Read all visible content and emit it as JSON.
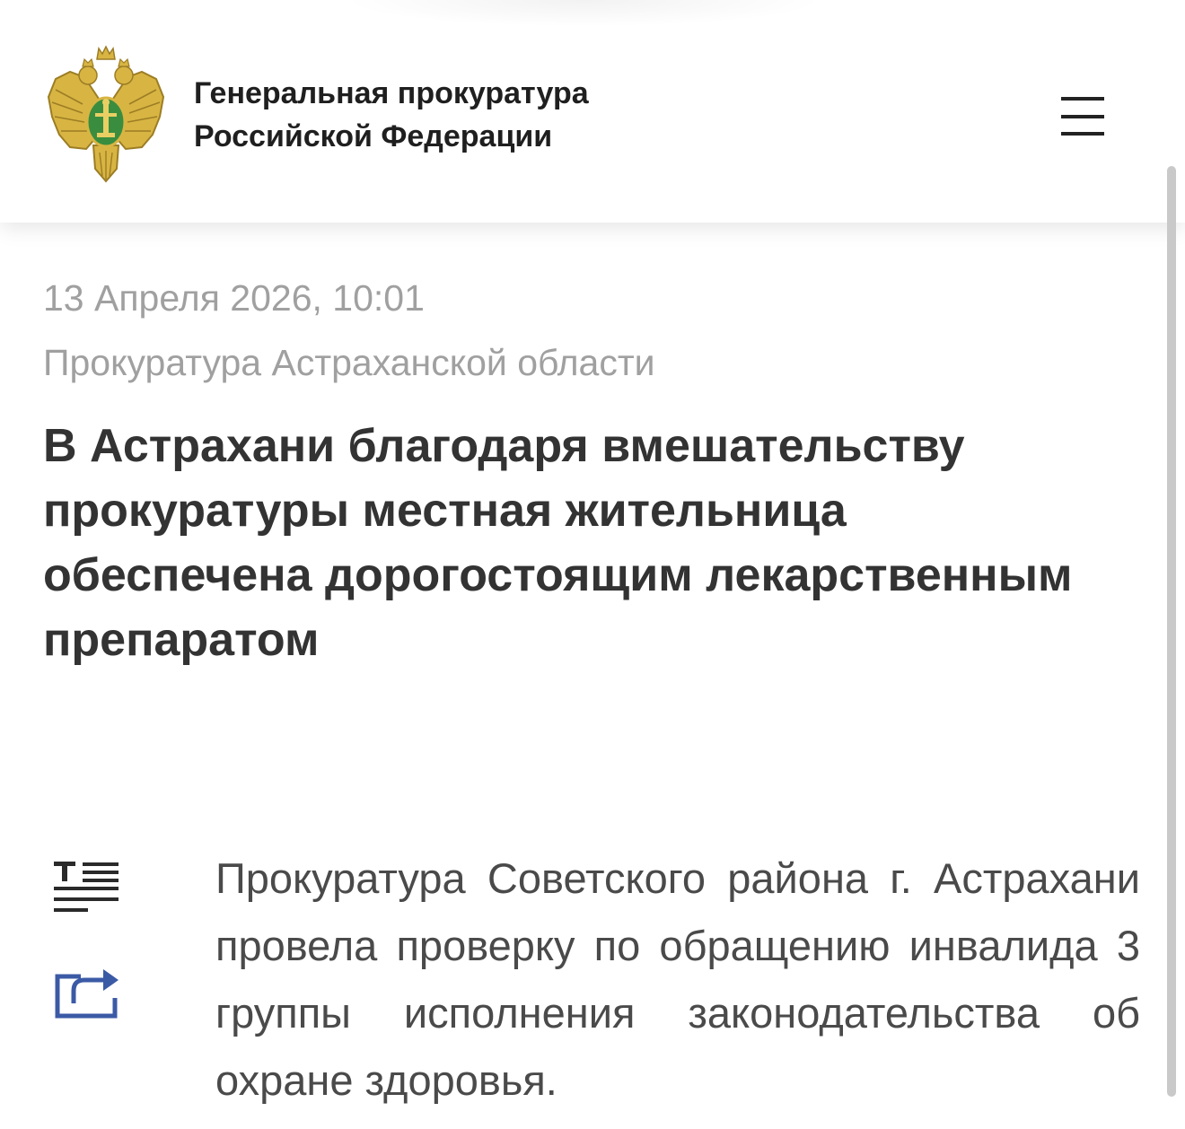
{
  "header": {
    "title": "Генеральная прокуратура Российской Федерации",
    "logo_icon": "coat-of-arms-icon",
    "menu_icon": "hamburger-menu-icon"
  },
  "article": {
    "date": "13 Апреля 2026, 10:01",
    "source": "Прокуратура Астраханской области",
    "headline": "В Астрахани благодаря вмешательству прокуратуры местная жительница обеспечена дорогостоящим лекарственным препаратом",
    "body": "Прокуратура Советского района г. Астрахани провела проверку по обращению инвалида 3 группы исполнения законодательства об охране здоровья."
  },
  "tools": {
    "text_size_icon": "text-size-icon",
    "share_icon": "share-icon"
  },
  "colors": {
    "headline": "#333333",
    "meta_text": "#a0a0a0",
    "body_text": "#4a4a4a",
    "share_accent": "#3b5aa6",
    "emblem_gold": "#d8b543",
    "emblem_green": "#3a8d3f"
  }
}
